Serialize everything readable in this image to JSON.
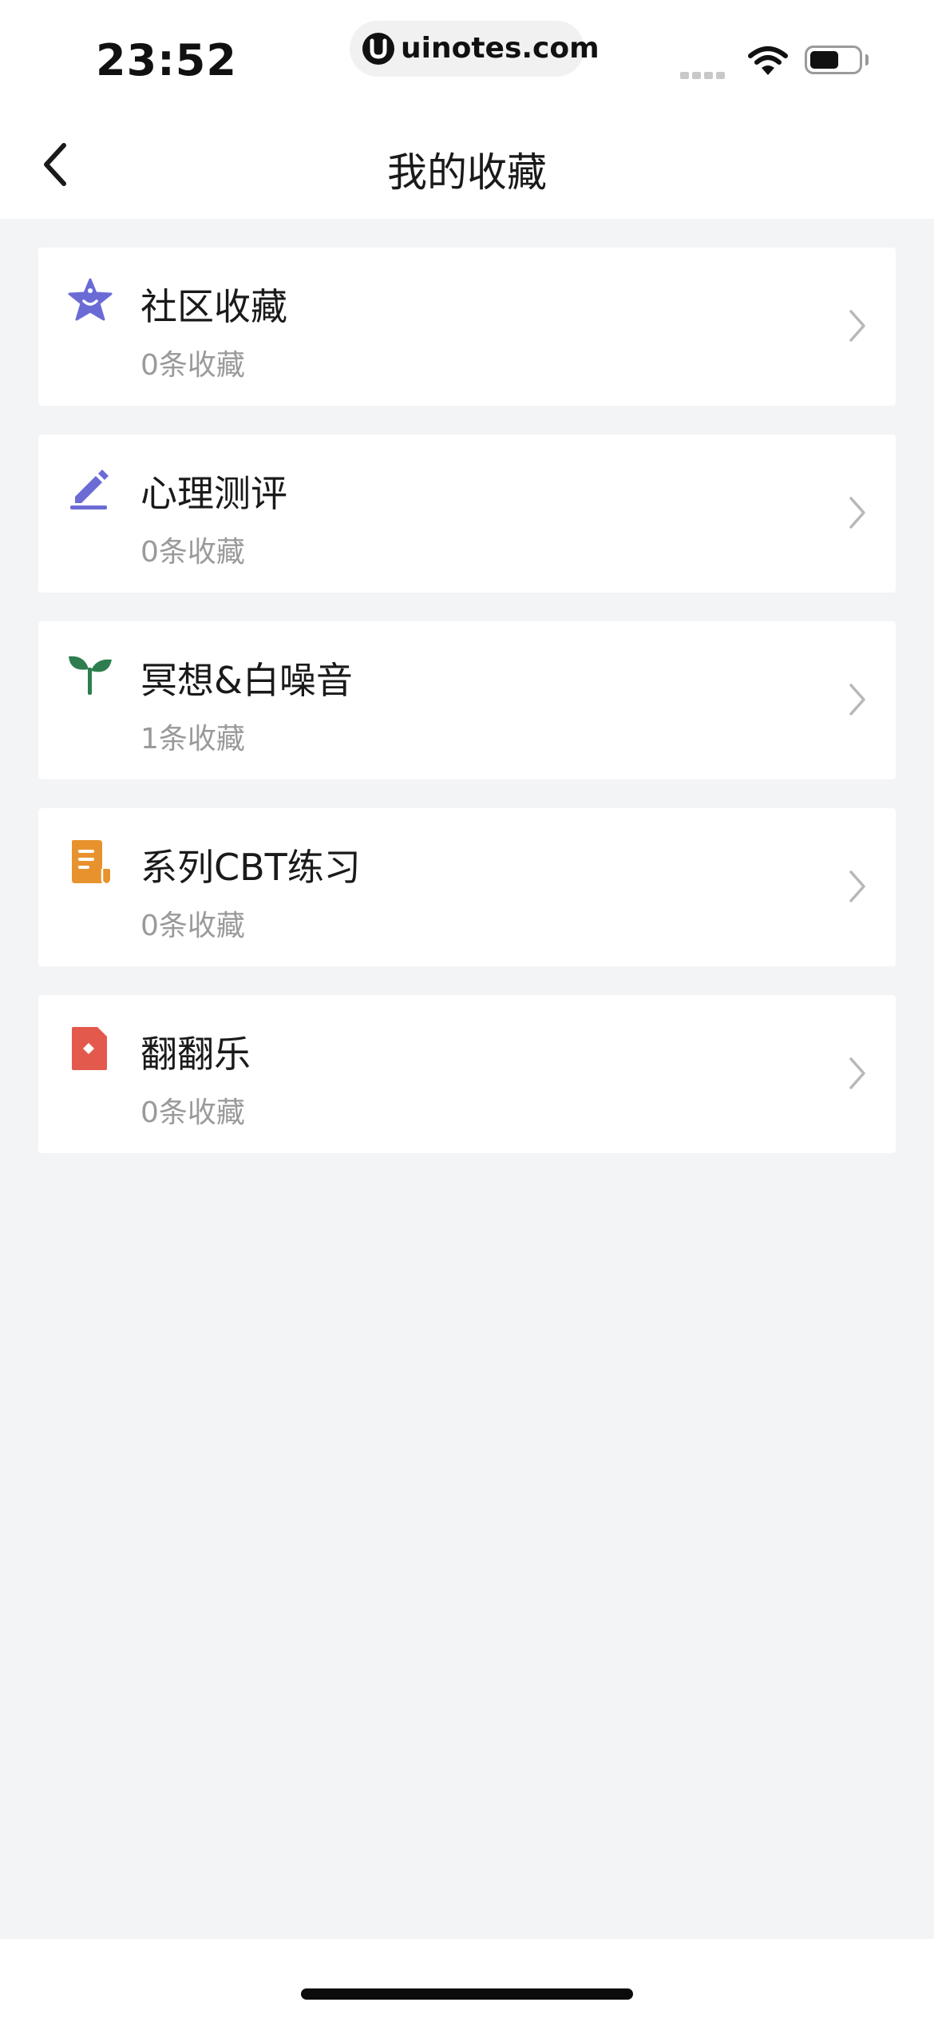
{
  "status_bar": {
    "time": "23:52",
    "url": "uinotes.com",
    "battery_level": 0.6
  },
  "navbar": {
    "title": "我的收藏"
  },
  "items": [
    {
      "title": "社区收藏",
      "subtitle": "0条收藏",
      "icon": "star-face-icon",
      "color": "#6b6bd6"
    },
    {
      "title": "心理测评",
      "subtitle": "0条收藏",
      "icon": "pencil-icon",
      "color": "#6b6bd6"
    },
    {
      "title": "冥想&白噪音",
      "subtitle": "1条收藏",
      "icon": "sprout-icon",
      "color": "#2e7d4f"
    },
    {
      "title": "系列CBT练习",
      "subtitle": "0条收藏",
      "icon": "document-icon",
      "color": "#e8922e"
    },
    {
      "title": "翻翻乐",
      "subtitle": "0条收藏",
      "icon": "card-icon",
      "color": "#e35a4d"
    }
  ]
}
